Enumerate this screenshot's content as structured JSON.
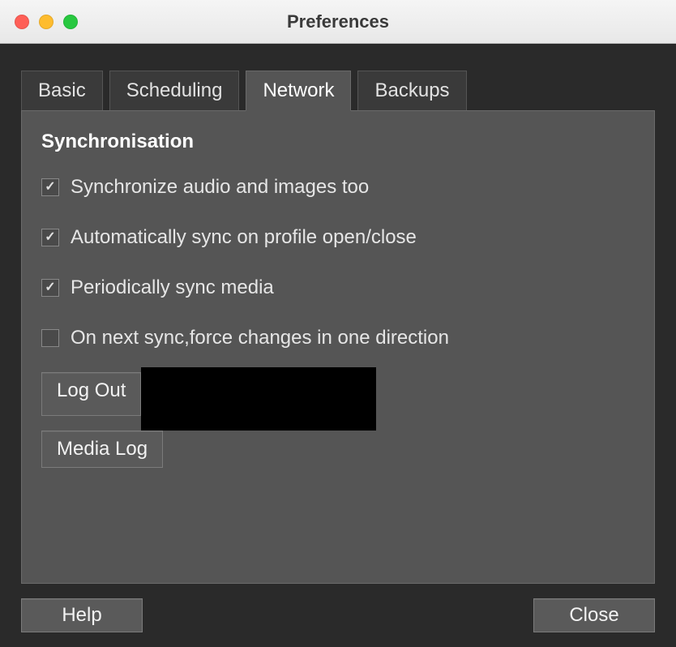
{
  "window": {
    "title": "Preferences"
  },
  "tabs": {
    "basic": "Basic",
    "scheduling": "Scheduling",
    "network": "Network",
    "backups": "Backups",
    "active": "network"
  },
  "section": {
    "title": "Synchronisation",
    "checkboxes": {
      "sync_media": {
        "label": "Synchronize audio and images too",
        "checked": true
      },
      "auto_sync": {
        "label": "Automatically sync on profile open/close",
        "checked": true
      },
      "periodic_media": {
        "label": "Periodically sync media",
        "checked": true
      },
      "force_changes": {
        "label": "On next sync,force changes in one direction",
        "checked": false
      }
    },
    "buttons": {
      "logout": "Log Out",
      "medialog": "Media Log"
    }
  },
  "footer": {
    "help": "Help",
    "close": "Close"
  }
}
